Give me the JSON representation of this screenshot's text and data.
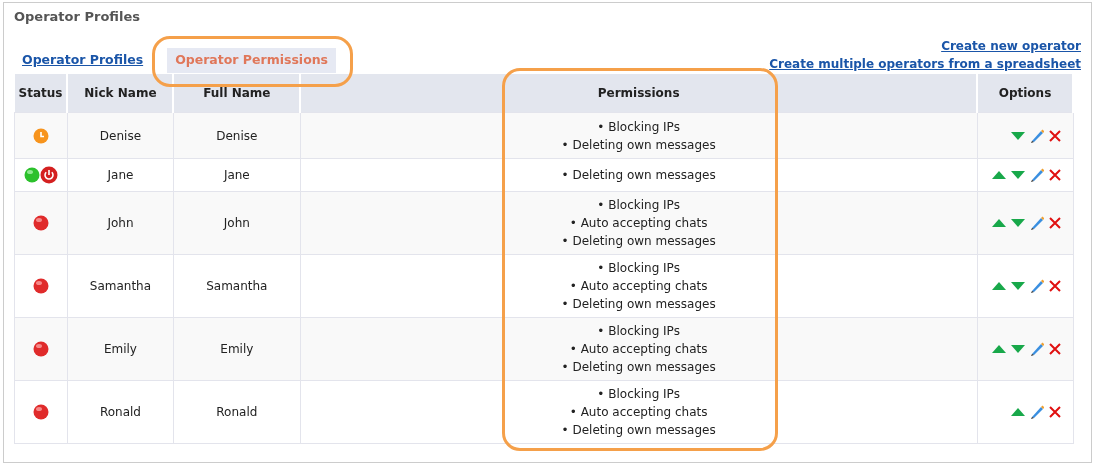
{
  "panel": {
    "title": "Operator Profiles"
  },
  "tabs": [
    {
      "label": "Operator Profiles",
      "selected": false,
      "highlighted": false
    },
    {
      "label": "Operator Permissions",
      "selected": true,
      "highlighted": true
    }
  ],
  "links": [
    "Create new operator",
    "Create multiple operators from a spreadsheet"
  ],
  "table": {
    "columns": [
      {
        "label": "Status",
        "highlighted": false
      },
      {
        "label": "Nick Name",
        "highlighted": false
      },
      {
        "label": "Full Name",
        "highlighted": false
      },
      {
        "label": "Permissions",
        "highlighted": true
      },
      {
        "label": "Options",
        "highlighted": false
      }
    ],
    "rows": [
      {
        "status": [
          {
            "kind": "away"
          }
        ],
        "nick": "Denise",
        "full": "Denise",
        "permissions": [
          "• Blocking IPs",
          "• Deleting own messages"
        ],
        "can_move_up": false,
        "can_move_down": true
      },
      {
        "status": [
          {
            "kind": "online"
          },
          {
            "kind": "power"
          }
        ],
        "nick": "Jane",
        "full": "Jane",
        "permissions": [
          "• Deleting own messages"
        ],
        "can_move_up": true,
        "can_move_down": true
      },
      {
        "status": [
          {
            "kind": "offline"
          }
        ],
        "nick": "John",
        "full": "John",
        "permissions": [
          "• Blocking IPs",
          "• Auto accepting chats",
          "• Deleting own messages"
        ],
        "can_move_up": true,
        "can_move_down": true
      },
      {
        "status": [
          {
            "kind": "offline"
          }
        ],
        "nick": "Samantha",
        "full": "Samantha",
        "permissions": [
          "• Blocking IPs",
          "• Auto accepting chats",
          "• Deleting own messages"
        ],
        "can_move_up": true,
        "can_move_down": true
      },
      {
        "status": [
          {
            "kind": "offline"
          }
        ],
        "nick": "Emily",
        "full": "Emily",
        "permissions": [
          "• Blocking IPs",
          "• Auto accepting chats",
          "• Deleting own messages"
        ],
        "can_move_up": true,
        "can_move_down": true
      },
      {
        "status": [
          {
            "kind": "offline"
          }
        ],
        "nick": "Ronald",
        "full": "Ronald",
        "permissions": [
          "• Blocking IPs",
          "• Auto accepting chats",
          "• Deleting own messages"
        ],
        "can_move_up": true,
        "can_move_down": false
      }
    ]
  }
}
